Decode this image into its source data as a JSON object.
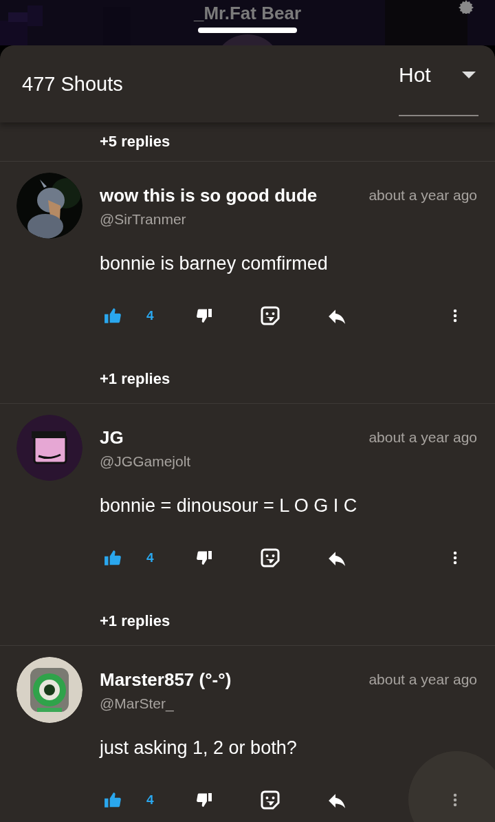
{
  "header": {
    "title": "_Mr.Fat Bear"
  },
  "sheet": {
    "count": "477 Shouts",
    "sort": {
      "label": "Hot"
    }
  },
  "top_replies": "+5 replies",
  "comments": [
    {
      "name": "wow this is so good dude",
      "handle": "@SirTranmer",
      "time": "about a year ago",
      "body": "bonnie is barney comfirmed",
      "likes": "4",
      "liked": true,
      "replies": "+1 replies"
    },
    {
      "name": "JG",
      "handle": "@JGGamejolt",
      "time": "about a year ago",
      "body": "bonnie = dinousour = L O G I C",
      "likes": "4",
      "liked": true,
      "replies": "+1 replies"
    },
    {
      "name": "Marster857 (°-°)",
      "handle": "@MarSter_",
      "time": "about a year ago",
      "body": "just asking 1, 2 or both?",
      "likes": "4",
      "liked": true
    }
  ]
}
